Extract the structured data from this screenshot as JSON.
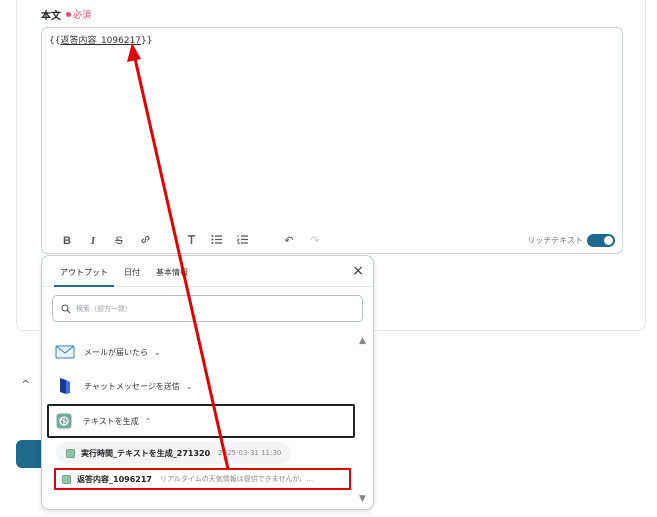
{
  "field": {
    "label": "本文",
    "required": "必須",
    "value_open": "{{",
    "value_var": "返答内容_1096217",
    "value_close": "}}"
  },
  "toolbar": {
    "bold": "B",
    "italic": "I",
    "strike": "S",
    "link": "🔗",
    "text_size": "T",
    "bullet_list": "☰",
    "numbered_list": "☷",
    "undo": "↶",
    "redo": "↷",
    "rich_text_label": "リッチテキスト",
    "rich_text_enabled": true
  },
  "panel": {
    "tabs": [
      {
        "label": "アウトプット",
        "active": true
      },
      {
        "label": "日付",
        "active": false
      },
      {
        "label": "基本情報",
        "active": false
      }
    ],
    "close_icon": "×",
    "search_placeholder": "検索（前方一致）",
    "groups": [
      {
        "label": "メールが届いたら",
        "icon": "mail-icon",
        "chevron": "⌄"
      },
      {
        "label": "チャットメッセージを送信",
        "icon": "chat-app-icon",
        "chevron": "⌄"
      },
      {
        "label": "テキストを生成",
        "icon": "ai-icon",
        "chevron": "⌃",
        "expanded": true
      }
    ],
    "sub_items": [
      {
        "name": "実行時間_テキストを生成_271320",
        "meta": "2025-03-31 11:30"
      },
      {
        "name": "返答内容_1096217",
        "meta": "リアルタイムの天気情報は提供できませんが、..."
      }
    ]
  },
  "colors": {
    "accent": "#1f6a8c",
    "required": "#e84a6a",
    "annotation": "#e00000"
  }
}
